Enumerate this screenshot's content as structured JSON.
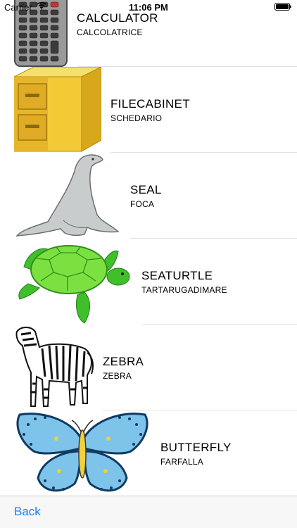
{
  "status_bar": {
    "carrier": "Carrier",
    "time": "11:06 PM",
    "wifi_icon": "wifi-icon",
    "battery_icon": "battery-icon"
  },
  "items": [
    {
      "title": "CALCULATOR",
      "subtitle": "CALCOLATRICE",
      "image": "calculator-image"
    },
    {
      "title": "FILECABINET",
      "subtitle": "SCHEDARIO",
      "image": "filecabinet-image"
    },
    {
      "title": "SEAL",
      "subtitle": "FOCA",
      "image": "seal-image"
    },
    {
      "title": "SEATURTLE",
      "subtitle": "TARTARUGADIMARE",
      "image": "seaturtle-image"
    },
    {
      "title": "ZEBRA",
      "subtitle": "ZEBRA",
      "image": "zebra-image"
    },
    {
      "title": "BUTTERFLY",
      "subtitle": "FARFALLA",
      "image": "butterfly-image"
    }
  ],
  "toolbar": {
    "back_label": "Back"
  },
  "colors": {
    "accent": "#1a7cf7",
    "separator": "#e2e2e4",
    "toolbar_bg": "#f7f7f7"
  }
}
